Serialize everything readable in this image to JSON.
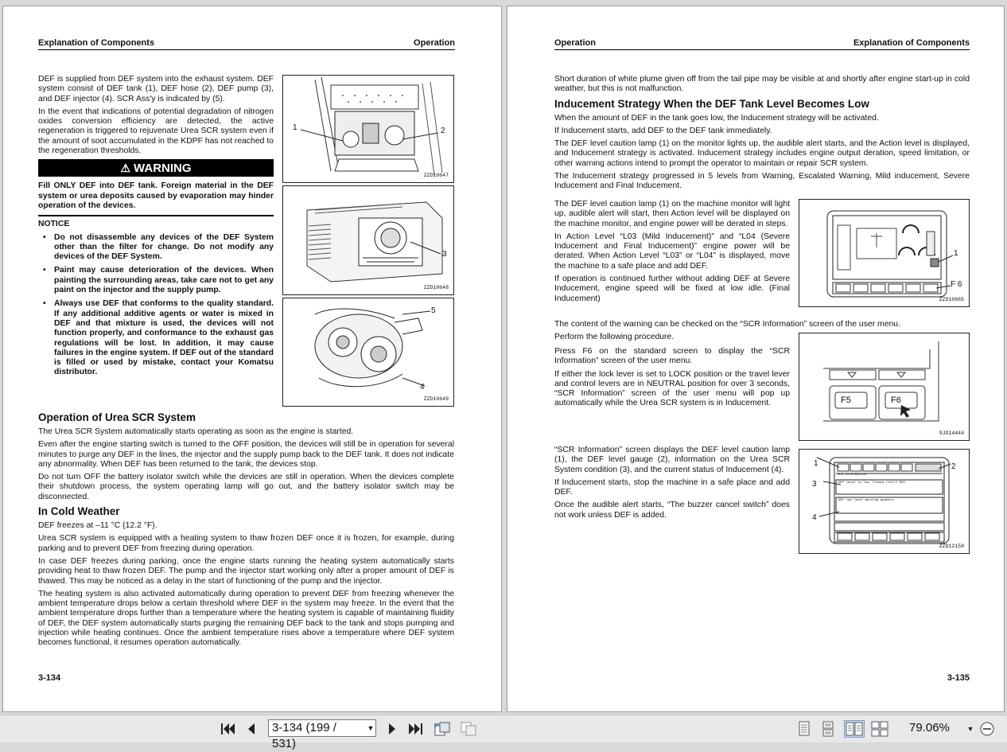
{
  "left": {
    "header_left": "Explanation of Components",
    "header_right": "Operation",
    "intro1": "DEF is supplied from DEF system into the exhaust system. DEF system consist of DEF tank (1), DEF hose (2), DEF pump (3), and DEF injector (4). SCR Ass'y is indicated by (5).",
    "intro2": "In the event that indications of potential degradation of nitrogen oxides conversion efficiency are detected, the active regeneration is triggered to rejuvenate Urea SCR system even if the amount of soot accumulated in the KDPF has not reached to the regeneration thresholds.",
    "warning_label": "WARNING",
    "warning_text": "Fill ONLY DEF into DEF tank. Foreign material in the DEF system or urea deposits caused by evaporation may hinder operation of the devices.",
    "notice_title": "NOTICE",
    "notice_items": [
      "Do not disassemble any devices of the DEF System other than the filter for change. Do not modify any devices of the DEF System.",
      "Paint may cause deterioration of the devices. When painting the surrounding areas, take care not to get any paint on the injector and the supply pump.",
      "Always use DEF that conforms to the quality standard. If any additional additive agents or water is mixed in DEF and that mixture is used, the devices will not function properly, and conformance to the exhaust gas regulations will be lost. In addition, it may cause failures in the engine system. If DEF out of the standard is filled or used by mistake, contact your Komatsu distributor."
    ],
    "h_operation": "Operation of Urea SCR System",
    "op1": "The Urea SCR System automatically starts operating as soon as the engine is started.",
    "op2": "Even after the engine starting switch is turned to the OFF position, the devices will still be in operation for several minutes to purge any DEF in the lines, the injector and the supply pump back to the DEF tank. It does not indicate any abnormality. When DEF has been returned to the tank, the devices stop.",
    "op3": "Do not turn OFF the battery isolator switch while the devices are still in operation. When the devices complete their shutdown process, the system operating lamp will go out, and the battery isolator switch may be disconnected.",
    "h_cold": "In Cold Weather",
    "cold1": "DEF freezes at –11 °C {12.2 °F}.",
    "cold2": "Urea SCR system is equipped with a heating system to thaw frozen DEF once it is frozen, for example, during parking and to prevent DEF from freezing during operation.",
    "cold3": "In case DEF freezes during parking, once the engine starts running the heating system automatically starts providing heat to thaw frozen DEF. The pump and the injector start working only after a proper amount of DEF is thawed. This may be noticed as a delay in the start of functioning of the pump and the injector.",
    "cold4": "The heating system is also activated automatically during operation to prevent DEF from freezing whenever the ambient temperature drops below a certain threshold where DEF in the system may freeze. In the event that the ambient temperature drops further than a temperature where the heating system is capable of maintaining fluidity of DEF, the DEF system automatically starts purging the remaining DEF back to the tank and stops pumping and injection while heating continues. Once the ambient temperature rises above a temperature where DEF system becomes functional, it resumes operation automatically.",
    "page_number": "3-134",
    "fig1_id": "ZZD10647",
    "fig2_id": "ZZD10648",
    "fig3_id": "ZZD10649",
    "callout_1": "1",
    "callout_2": "2",
    "callout_3": "3",
    "callout_4": "4",
    "callout_5": "5"
  },
  "right": {
    "header_left": "Operation",
    "header_right": "Explanation of Components",
    "p0": "Short duration of white plume given off from the tail pipe may be visible at and shortly after engine start-up in cold weather, but this is not malfunction.",
    "h_inducement": "Inducement Strategy When the DEF Tank Level Becomes Low",
    "p1": "When the amount of DEF in the tank goes low, the Inducement strategy will be activated.",
    "p2": "If Inducement starts, add DEF to the DEF tank immediately.",
    "p3": "The DEF level caution lamp (1) on the monitor lights up, the audible alert starts, and the Action level is displayed, and Inducement strategy is activated. Inducement strategy includes engine output deration, speed limitation, or other warning actions intend to prompt the operator to maintain or repair SCR system.",
    "p4": "The Inducement strategy progressed in 5 levels from Warning, Escalated Warning, Mild inducement, Severe Inducement and Final Inducement.",
    "p5": "The DEF level caution lamp (1) on the machine monitor will light up, audible alert will start, then Action level will be displayed on the machine monitor, and engine power will be derated in steps.",
    "p6": "In Action Level “L03 (Mild Inducement)” and “L04 (Severe Inducement and Final Inducement)” engine power will be derated. When Action Level “L03” or “L04” is displayed, move the machine to a safe place and add DEF.",
    "p7": "If operation is continued further without adding DEF at Severe Inducement, engine speed will be fixed at low idle. (Final Inducement)",
    "p8": "The content of the warning can be checked on the “SCR Information” screen of the user menu.",
    "p9": "Perform the following procedure.",
    "p10": "Press F6 on the standard screen to display the “SCR Information” screen of the user menu.",
    "p11": "If either the lock lever is set to LOCK position or the travel lever and control levers are in NEUTRAL position for over 3 seconds, “SCR Information” screen of the user menu will pop up automatically while the Urea SCR system is in Inducement.",
    "p12": "“SCR Information” screen displays the DEF level caution lamp (1), the DEF level gauge (2), information on the Urea SCR System condition (3), and the current status of Inducement (4).",
    "p13": "If Inducement starts, stop the machine in a safe place and add DEF.",
    "p14": "Once the audible alert starts, “The buzzer cancel switch” does not work unless DEF is added.",
    "page_number": "3-135",
    "fig4_id": "ZZD10665",
    "fig5_id": "9JD14444",
    "fig6_id": "ZZD12158",
    "fig4_callout_1": "1",
    "fig4_callout_f6": "F 6",
    "f5_label": "F5",
    "f6_label": "F6",
    "fig6_callout_1": "1",
    "fig6_callout_2": "2",
    "fig6_callout_3": "3",
    "fig6_callout_4": "4",
    "scr_screen_title": "SCR Information",
    "scr_msg1": "DEF level is low. Please refill DEF.",
    "scr_msg2": "DEF low level warning appears."
  },
  "toolbar": {
    "page_value": "3-134 (199 / 531)",
    "zoom": "79.06%"
  }
}
